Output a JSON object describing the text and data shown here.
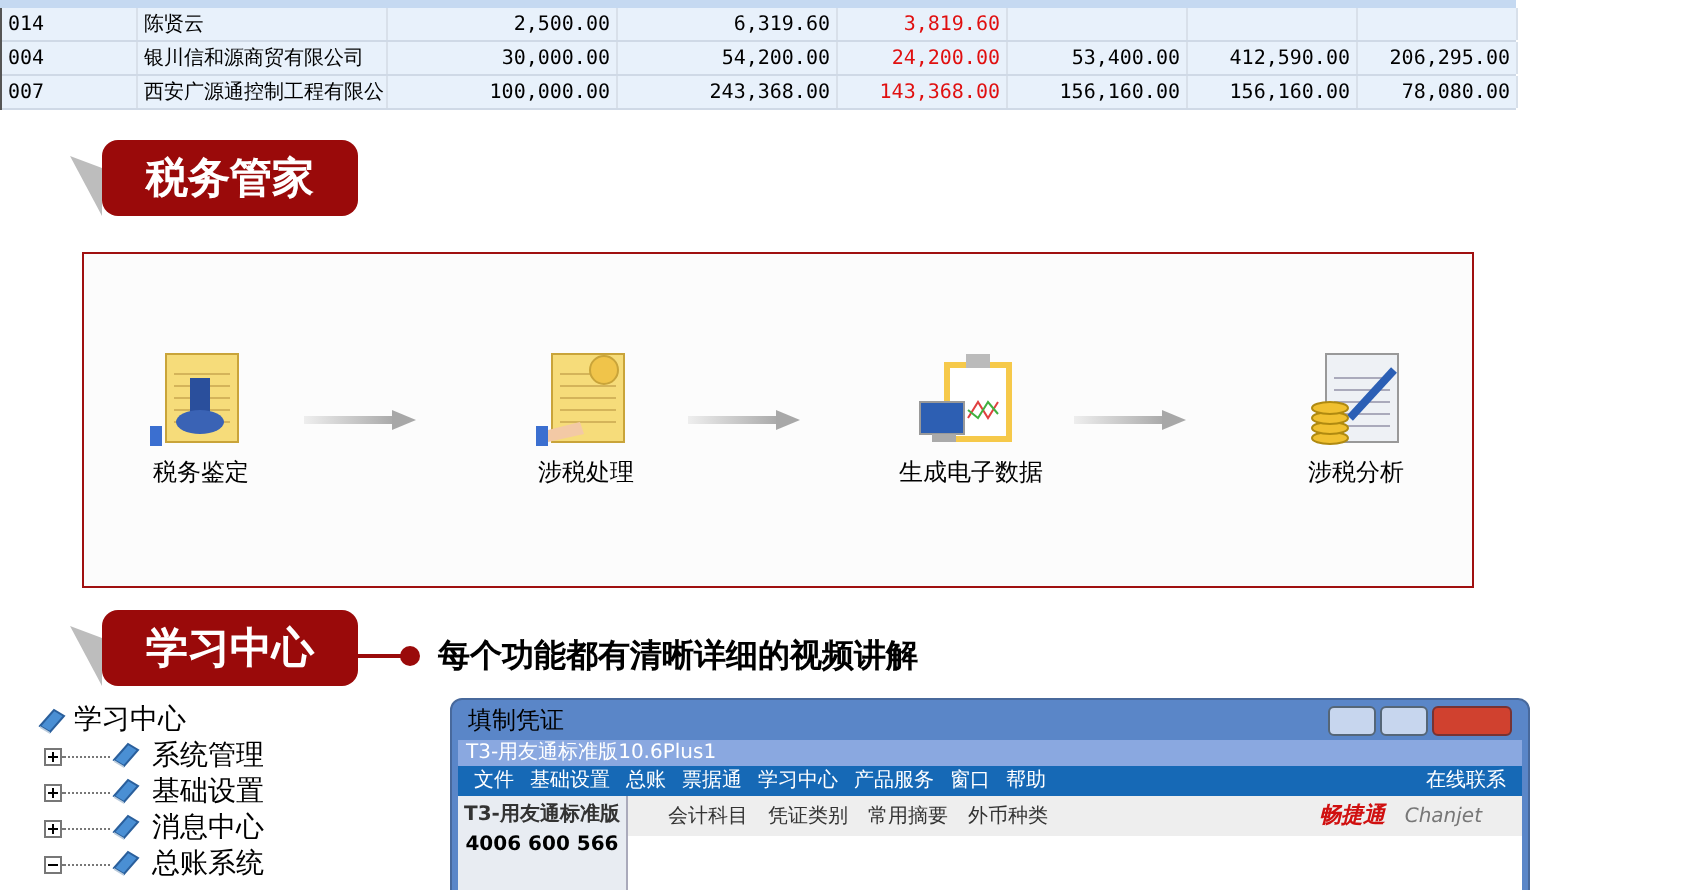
{
  "table": {
    "columns": [
      {
        "kind": "text"
      },
      {
        "kind": "text"
      },
      {
        "kind": "amount"
      },
      {
        "kind": "amount"
      },
      {
        "kind": "difference"
      },
      {
        "kind": "amount"
      },
      {
        "kind": "amount"
      },
      {
        "kind": "amount"
      }
    ],
    "rows": [
      {
        "cells": [
          "014",
          "陈贤云",
          "2,500.00",
          "6,319.60",
          "3,819.60",
          "",
          "",
          ""
        ]
      },
      {
        "cells": [
          "004",
          "银川信和源商贸有限公司",
          "30,000.00",
          "54,200.00",
          "24,200.00",
          "53,400.00",
          "412,590.00",
          "206,295.00"
        ]
      },
      {
        "cells": [
          "007",
          "西安广源通控制工程有限公",
          "100,000.00",
          "243,368.00",
          "143,368.00",
          "156,160.00",
          "156,160.00",
          "78,080.00"
        ]
      }
    ]
  },
  "tax_section": {
    "heading": "税务管家",
    "steps": [
      {
        "label": "税务鉴定",
        "kind": "stamp"
      },
      {
        "label": "涉税处理",
        "kind": "coin"
      },
      {
        "label": "生成电子数据",
        "kind": "computer"
      },
      {
        "label": "涉税分析",
        "kind": "analysis"
      }
    ]
  },
  "learning_section": {
    "heading": "学习中心",
    "slogan": "每个功能都有清晰详细的视频讲解",
    "tree": {
      "label": "学习中心",
      "children": [
        {
          "label": "系统管理",
          "expanded": false
        },
        {
          "label": "基础设置",
          "expanded": false
        },
        {
          "label": "消息中心",
          "expanded": false
        },
        {
          "label": "总账系统",
          "expanded": true
        }
      ]
    },
    "screenshot": {
      "title": "填制凭证",
      "app_title": "T3-用友通标准版10.6Plus1",
      "menu": [
        "文件",
        "基础设置",
        "总账",
        "票据通",
        "学习中心",
        "产品服务",
        "窗口",
        "帮助"
      ],
      "online_contact": "在线联系",
      "brand_title": "T3-用友通标准版",
      "phone": "4006 600 566",
      "toolbar": [
        "会计科目",
        "凭证类别",
        "常用摘要",
        "外币种类"
      ],
      "logo": "畅捷通",
      "logo_sub": "Chanjet"
    }
  }
}
